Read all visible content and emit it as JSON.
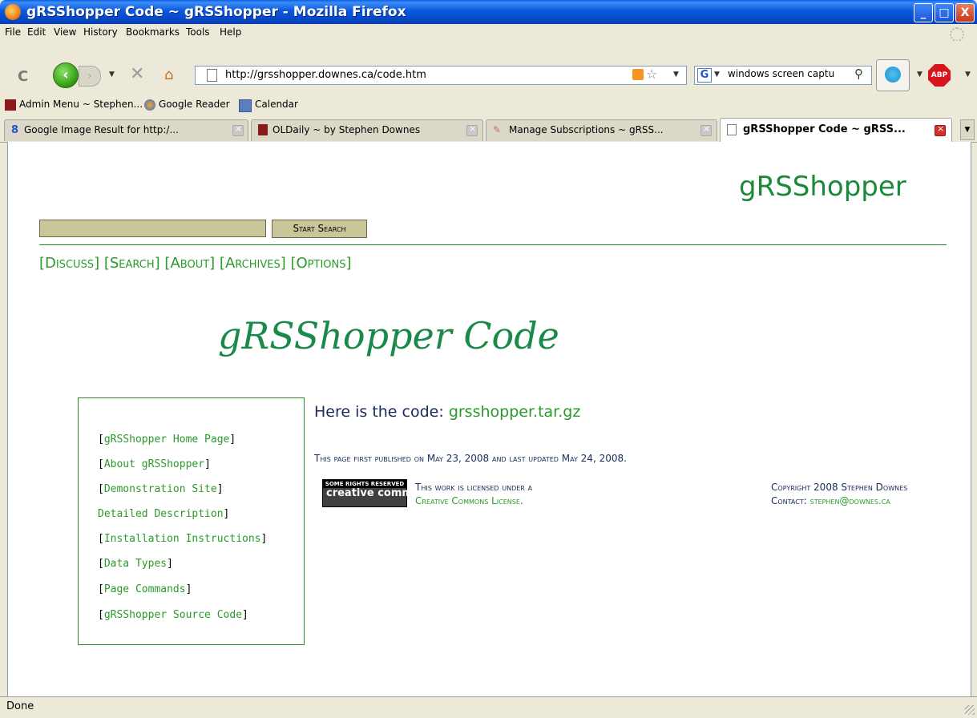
{
  "window": {
    "title": "gRSShopper Code ~ gRSShopper - Mozilla Firefox",
    "minimize_glyph": "_",
    "maximize_glyph": "□",
    "close_glyph": "X"
  },
  "menu": {
    "items": [
      {
        "label": "File"
      },
      {
        "label": "Edit"
      },
      {
        "label": "View"
      },
      {
        "label": "History"
      },
      {
        "label": "Bookmarks"
      },
      {
        "label": "Tools"
      },
      {
        "label": "Help"
      }
    ]
  },
  "navbar": {
    "url": "http://grsshopper.downes.ca/code.htm",
    "search_text": "windows screen captu",
    "reload_glyph": "C",
    "back_glyph": "‹",
    "forward_glyph": "›",
    "stop_glyph": "✕",
    "home_glyph": "⌂",
    "star_glyph": "☆",
    "magnifier_glyph": "⚲",
    "search_engine_glyph": "G",
    "abp_label": "ABP",
    "icons": [
      "reload-icon",
      "back-arrow-icon",
      "forward-arrow-icon",
      "stop-icon",
      "home-icon",
      "page-icon",
      "rss-icon",
      "star-icon",
      "google-icon",
      "magnifier-icon",
      "skype-icon",
      "adblock-icon"
    ]
  },
  "bookmarks": [
    {
      "label": "Admin Menu ~ Stephen..."
    },
    {
      "label": "Google Reader"
    },
    {
      "label": "Calendar"
    }
  ],
  "tabs": [
    {
      "label": "Google Image Result for http:/...",
      "active": false
    },
    {
      "label": "OLDaily ~ by Stephen Downes",
      "active": false
    },
    {
      "label": "Manage Subscriptions ~ gRSS...",
      "active": false
    },
    {
      "label": "gRSShopper Code ~ gRSS...",
      "active": true
    }
  ],
  "page": {
    "brand": "gRSShopper",
    "search_button": "Start Search",
    "search_value": "",
    "topnav": [
      {
        "label": "Discuss"
      },
      {
        "label": "Search"
      },
      {
        "label": "About"
      },
      {
        "label": "Archives"
      },
      {
        "label": "Options"
      }
    ],
    "title": "gRSShopper Code",
    "sidebar_links": [
      {
        "label": "gRSShopper Home Page",
        "open": "[",
        "close": "]"
      },
      {
        "label": "About gRSShopper",
        "open": "[",
        "close": "]"
      },
      {
        "label": "Demonstration Site",
        "open": "[",
        "close": "]"
      },
      {
        "label": "Detailed Description",
        "open": "",
        "close": "]"
      },
      {
        "label": "Installation Instructions",
        "open": "[",
        "close": "]"
      },
      {
        "label": "Data Types",
        "open": "[",
        "close": "]"
      },
      {
        "label": "Page Commands",
        "open": "[",
        "close": "]"
      },
      {
        "label": "gRSShopper Source Code",
        "open": "[",
        "close": "]"
      }
    ],
    "code_prefix": "Here is the code:",
    "code_link": "grsshopper.tar.gz",
    "published": "This page first published on May 23, 2008 and last updated May 24, 2008.",
    "cc_badge_top": "SOME RIGHTS RESERVED",
    "cc_badge_main": "creative commons",
    "license_prefix": "This work is licensed under a",
    "license_link": "Creative Commons License.",
    "copyright": "Copyright 2008 Stephen Downes",
    "contact_prefix": "Contact:",
    "contact_email": "stephen@downes.ca"
  },
  "status": {
    "text": "Done"
  },
  "colors": {
    "accent_green": "#2a9a2a",
    "title_green": "#1a8a4a",
    "search_field": "#c9c69a",
    "xp_titlebar": "#0A58DF"
  }
}
